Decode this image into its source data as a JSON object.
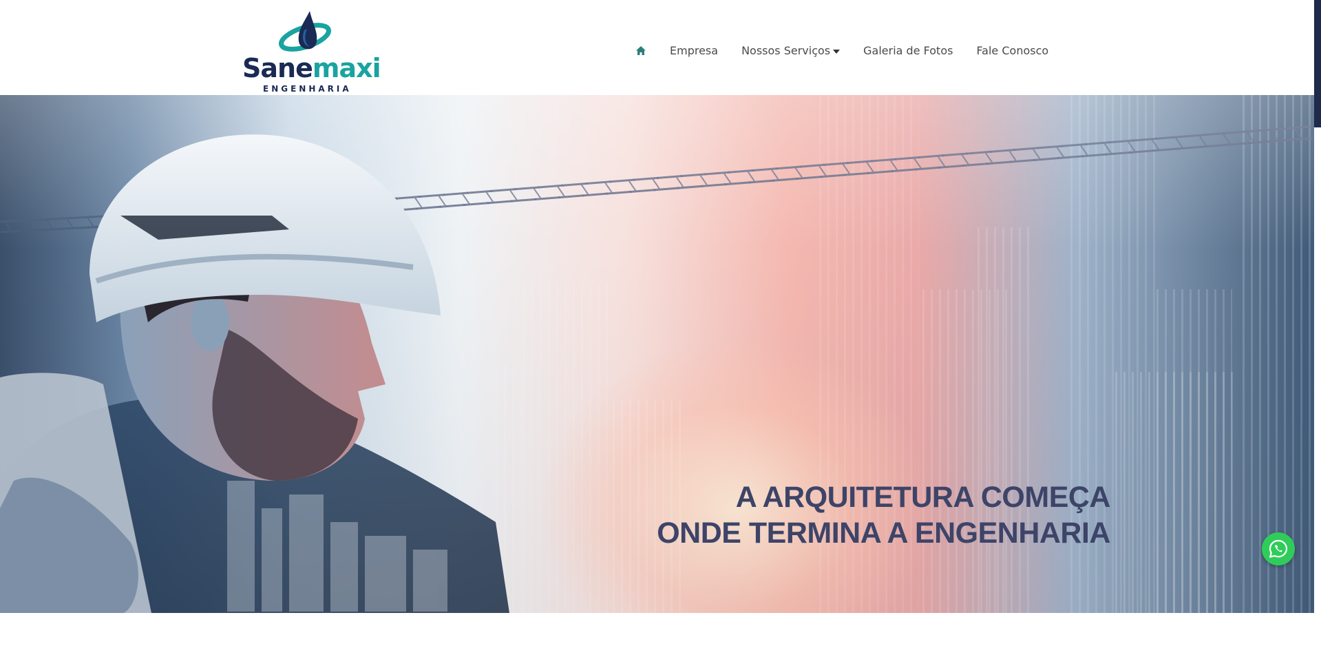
{
  "brand": {
    "name_part1": "Sane",
    "name_part2": "maxi",
    "tagline": "ENGENHARIA",
    "primary_color": "#1a2a55",
    "accent_color": "#1aa3a0"
  },
  "nav": {
    "home_icon": "home-icon",
    "items": [
      {
        "label": "Empresa"
      },
      {
        "label": "Nossos Serviços",
        "has_dropdown": true
      },
      {
        "label": "Galeria de Fotos"
      },
      {
        "label": "Fale Conosco"
      }
    ]
  },
  "hero": {
    "headline_line1": "A ARQUITETURA COMEÇA",
    "headline_line2": "ONDE TERMINA A ENGENHARIA",
    "headline_color": "#3d4468"
  },
  "floating": {
    "whatsapp_icon": "whatsapp-icon",
    "whatsapp_color": "#2fcc5a"
  }
}
